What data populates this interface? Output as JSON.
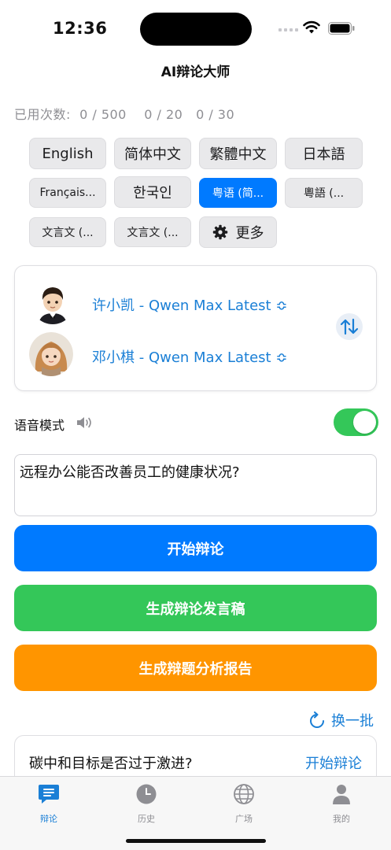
{
  "status_bar": {
    "time": "12:36"
  },
  "app": {
    "title": "AI辩论大师"
  },
  "usage": {
    "label": "已用次数:",
    "counts": "0 / 500    0 / 20   0 / 30"
  },
  "languages": {
    "row1": [
      "English",
      "简体中文",
      "繁體中文",
      "日本語"
    ],
    "row2": [
      "Français...",
      "한국인",
      "粤语 (简...",
      "粵語 (..."
    ],
    "row3": [
      "文言文 (...",
      "文言文 (..."
    ],
    "more_label": "更多",
    "selected": "粤语 (简..."
  },
  "debaters": {
    "first": {
      "name": "许小凯 - Qwen Max Latest ≎"
    },
    "second": {
      "name": "邓小棋 - Qwen Max Latest ≎"
    }
  },
  "voice_mode": {
    "label": "语音模式",
    "enabled": true
  },
  "topic": {
    "value": "远程办公能否改善员工的健康状况?"
  },
  "actions": {
    "start": "开始辩论",
    "speech": "生成辩论发言稿",
    "report": "生成辩题分析报告"
  },
  "suggestions": {
    "refresh_label": "换一批",
    "items": [
      {
        "question": "碳中和目标是否过于激进?",
        "action": "开始辩论"
      }
    ]
  },
  "tabbar": {
    "items": [
      {
        "label": "辩论",
        "icon": "chat-bubble-icon",
        "active": true
      },
      {
        "label": "历史",
        "icon": "clock-icon",
        "active": false
      },
      {
        "label": "广场",
        "icon": "globe-icon",
        "active": false
      },
      {
        "label": "我的",
        "icon": "person-icon",
        "active": false
      }
    ]
  },
  "colors": {
    "accent_blue": "#007aff",
    "link_blue": "#1a7fd6",
    "green": "#34c759",
    "orange": "#ff9500"
  }
}
